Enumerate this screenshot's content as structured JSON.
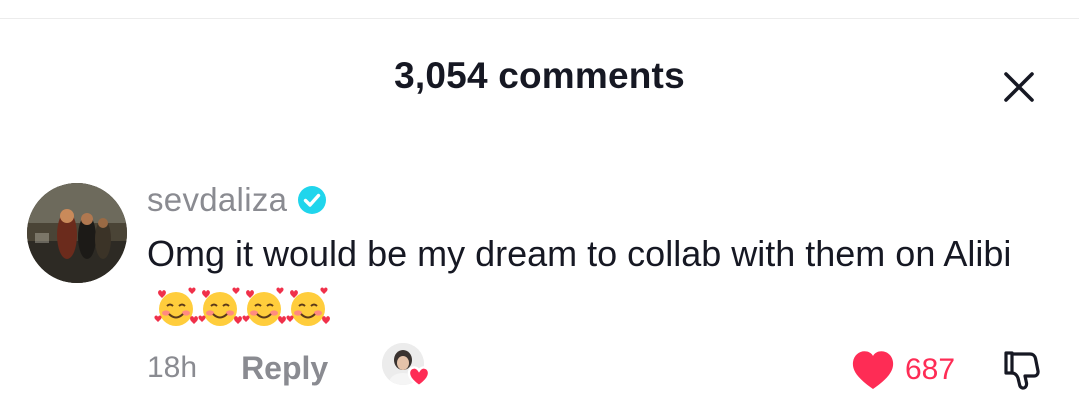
{
  "header": {
    "title": "3,054 comments",
    "close_icon": "close-icon"
  },
  "comment": {
    "username": "sevdaliza",
    "verified": true,
    "text": "Omg it would be my dream to collab with them on Alibi",
    "emojis": [
      "smiling-face-with-hearts",
      "smiling-face-with-hearts",
      "smiling-face-with-hearts",
      "smiling-face-with-hearts"
    ],
    "timestamp": "18h",
    "reply_label": "Reply",
    "creator_liked": true,
    "likes": "687",
    "liked": true
  },
  "colors": {
    "text_primary": "#161823",
    "text_secondary": "#8a8b91",
    "like_red": "#fe2c55",
    "verified_blue": "#20d5ec"
  }
}
